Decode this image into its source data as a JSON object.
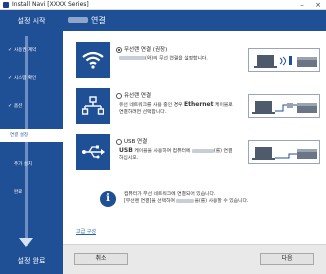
{
  "window": {
    "title": "Install Navi [XXXX Series]",
    "minimize_glyph": "–",
    "close_glyph": "×"
  },
  "sidebar": {
    "start_label": "설정 시작",
    "end_label": "설정 완료",
    "steps": [
      {
        "label": "사용권 계약",
        "done": true,
        "check": "✓"
      },
      {
        "label": "시스템 확인",
        "done": true,
        "check": "✓"
      },
      {
        "label": "옵션",
        "done": true,
        "check": "✓"
      },
      {
        "label": "연결 설정",
        "active": true
      },
      {
        "label": "추가 설치"
      },
      {
        "label": "완료"
      }
    ]
  },
  "header": {
    "title": "연결"
  },
  "options": [
    {
      "label": "무선랜 연결 (권장)",
      "selected": true,
      "desc": "(와)의 무선 연결을 설정합니다.",
      "icon": "wifi-icon"
    },
    {
      "label": "유선랜 연결",
      "selected": false,
      "desc_a": "유선 네트워크를 사용 중인 경우",
      "desc_em": "Ethernet",
      "desc_b": "케이블로",
      "desc_c": "연결하려면 선택합니다.",
      "icon": "network-icon"
    },
    {
      "label": "USB 연결",
      "selected": false,
      "desc_em": "USB",
      "desc_a": "케이블을 사용하여 컴퓨터에",
      "desc_b": "(를) 연결",
      "desc_c": "하십시오.",
      "icon": "usb-icon"
    }
  ],
  "info": {
    "glyph": "i",
    "line1": "컴퓨터가 무선 네트워크에 연결되어 있습니다.",
    "line2a": "[무선랜 연결]을 선택하여",
    "line2b": "을(를) 사용할 수 있습니다."
  },
  "advanced_link": "고급 구성",
  "buttons": {
    "cancel": "취소",
    "next": "다음"
  },
  "colors": {
    "brand": "#1f4f95",
    "link": "#2a5db0"
  }
}
